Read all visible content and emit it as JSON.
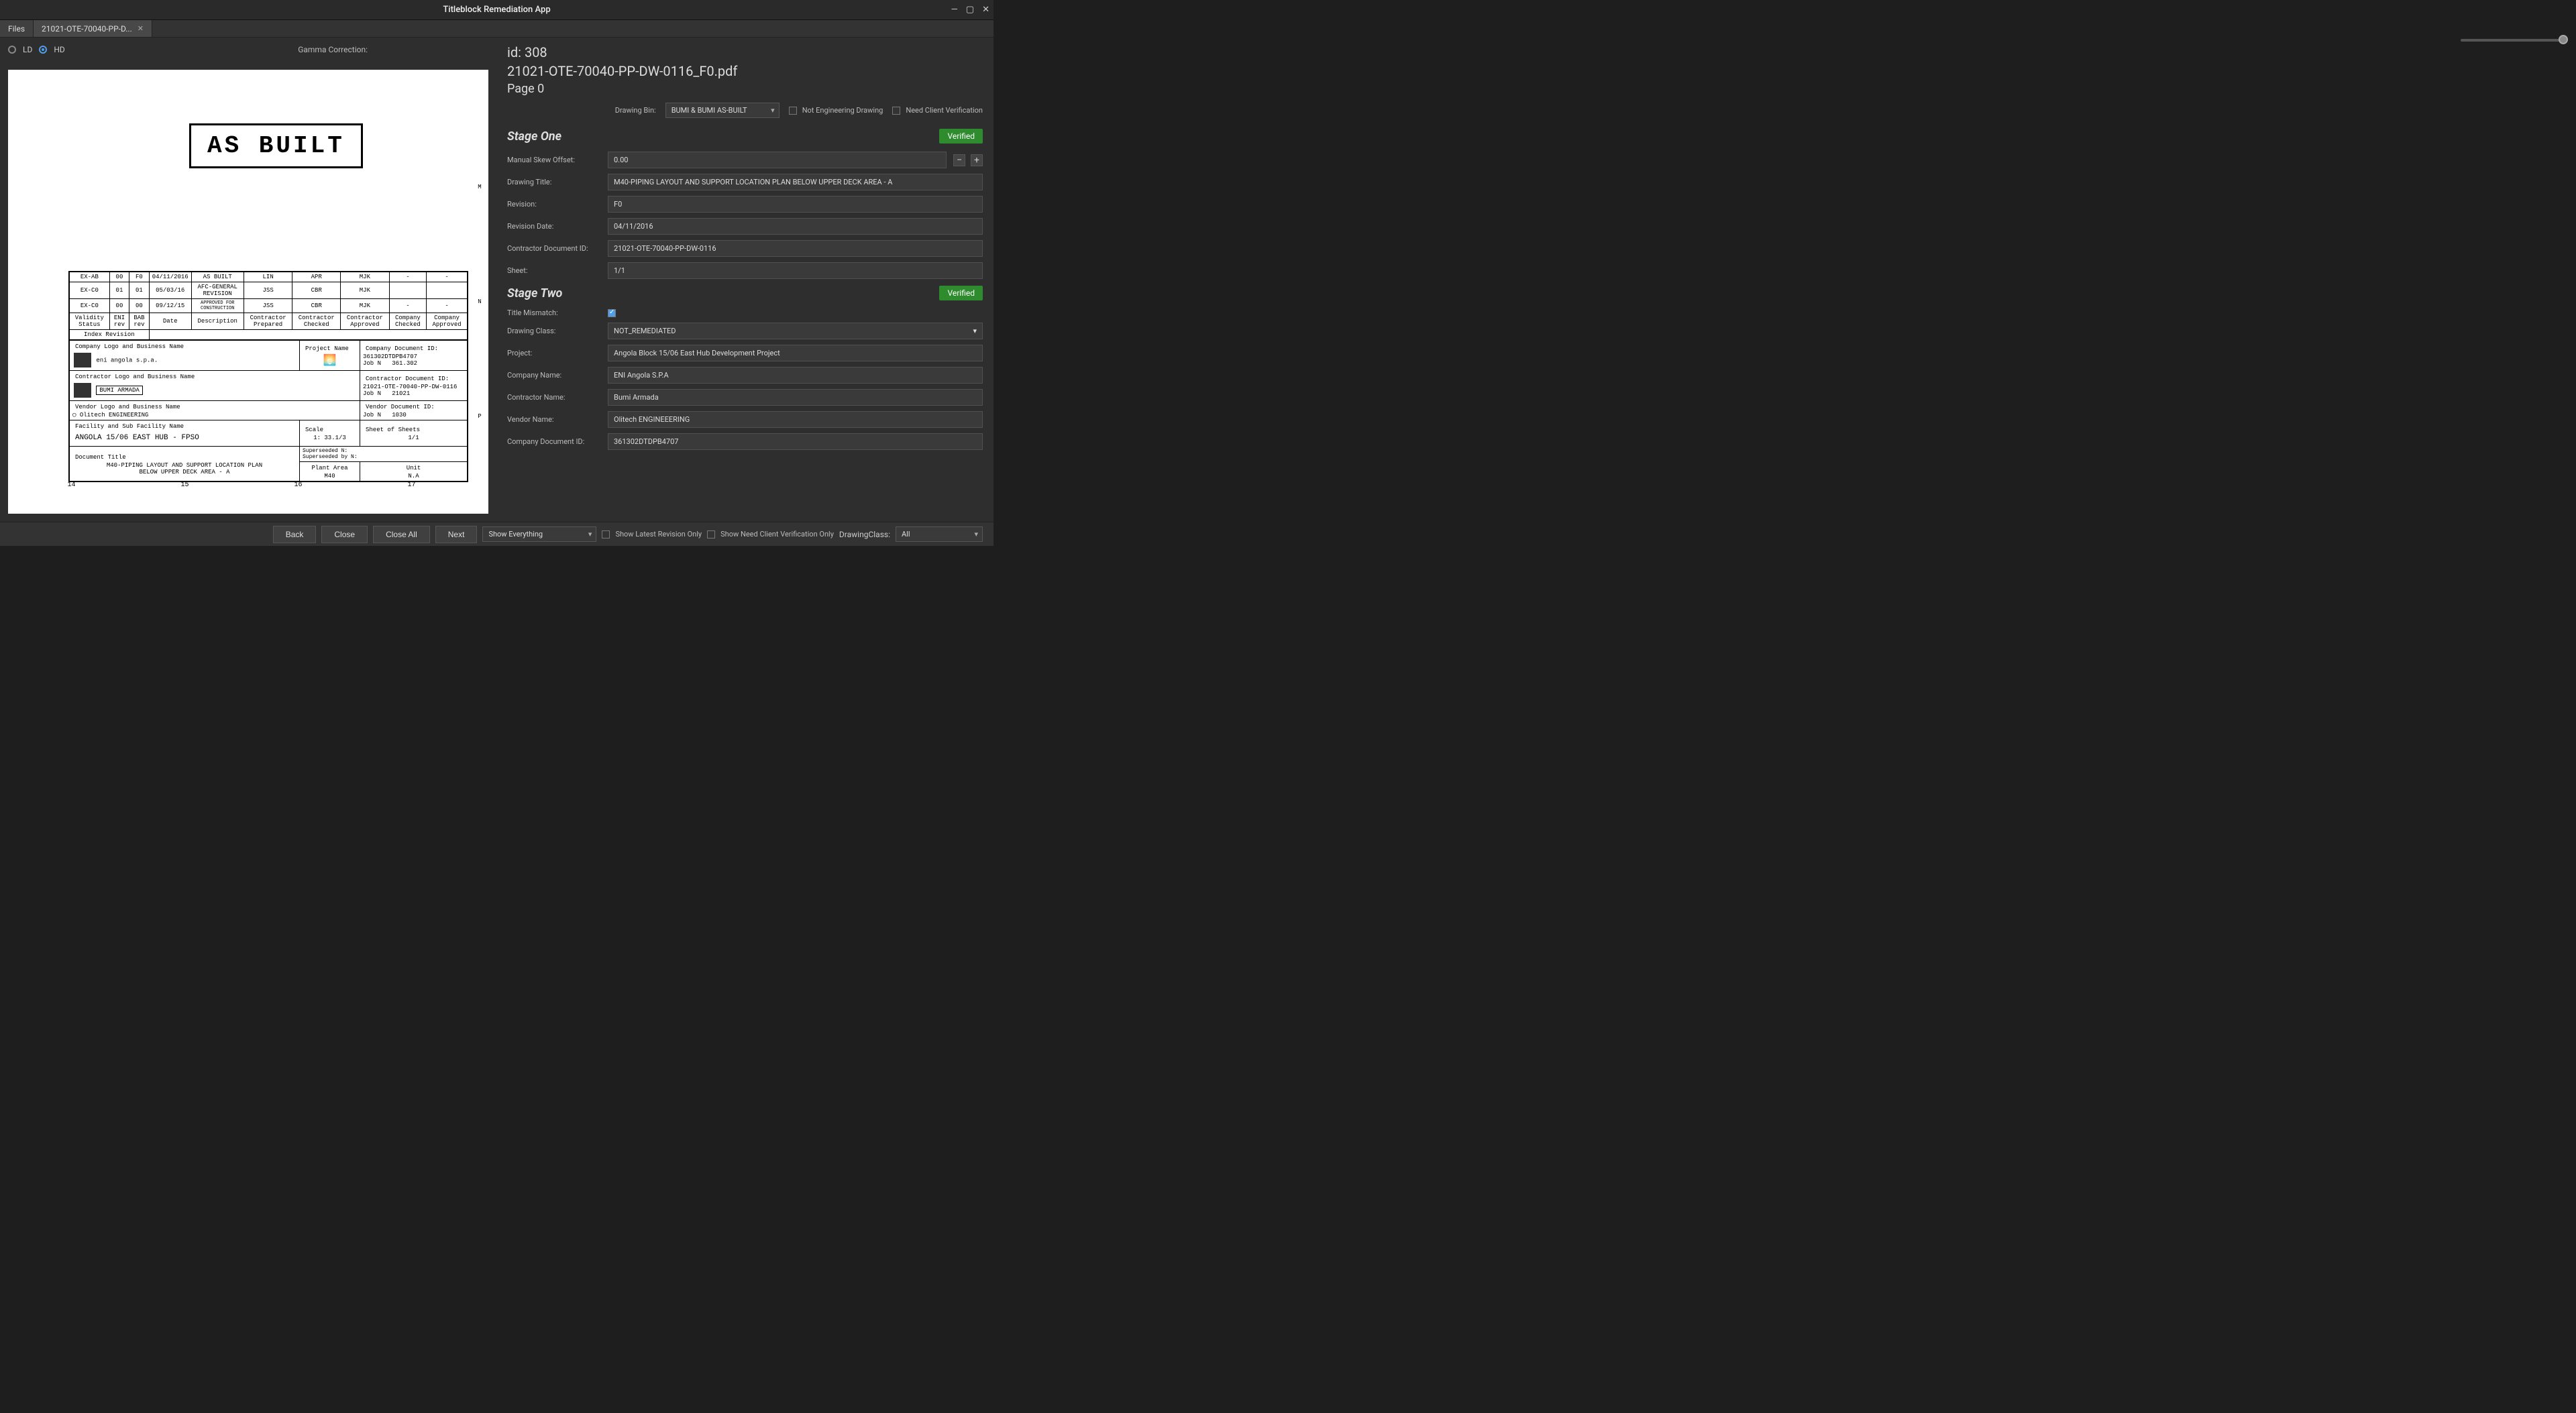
{
  "window": {
    "title": "Titleblock Remediation App"
  },
  "tabs": {
    "files": "Files",
    "docTab": "21021-OTE-70040-PP-D..."
  },
  "viewer": {
    "ldLabel": "LD",
    "hdLabel": "HD",
    "gammaLabel": "Gamma Correction:",
    "asbuilt": "AS BUILT",
    "rulerRight": {
      "m": "M",
      "n": "N",
      "p": "P"
    },
    "rulerBot": {
      "r14": "14",
      "r15": "15",
      "r16": "16",
      "r17": "17"
    },
    "revRows": [
      {
        "status": "EX-AB",
        "eni": "00",
        "bab": "F0",
        "date": "04/11/2016",
        "desc": "AS BUILT",
        "prep": "LIN",
        "chk": "APR",
        "appr": "MJK",
        "cchk": "-",
        "capp": "-"
      },
      {
        "status": "EX-C0",
        "eni": "01",
        "bab": "01",
        "date": "05/03/16",
        "desc": "AFC-GENERAL REVISION",
        "prep": "JSS",
        "chk": "CBR",
        "appr": "MJK",
        "cchk": "",
        "capp": ""
      },
      {
        "status": "EX-C0",
        "eni": "00",
        "bab": "00",
        "date": "09/12/15",
        "desc": "APPROVED FOR CONSTRUCTION",
        "prep": "JSS",
        "chk": "CBR",
        "appr": "MJK",
        "cchk": "-",
        "capp": "-"
      }
    ],
    "revHdr": {
      "status": "Validity Status",
      "eni": "ENI rev",
      "bab": "BAB rev",
      "date": "Date",
      "desc": "Description",
      "prep": "Contractor Prepared",
      "chk": "Contractor Checked",
      "appr": "Contractor Approved",
      "cchk": "Company Checked",
      "capp": "Company Approved"
    },
    "indexRev": "Index Revision",
    "companyLogoLbl": "Company Logo and Business Name",
    "companyName": "eni angola s.p.a.",
    "projectNameLbl": "Project Name",
    "compDocIdLbl": "Company Document ID:",
    "compDocId": "361302DTDPB4707",
    "jobNLbl": "Job N",
    "jobN1": "361.302",
    "contractorLogoLbl": "Contractor Logo and Business Name",
    "contractorName": "BUMI ARMADA",
    "contrDocIdLbl": "Contractor Document ID:",
    "contrDocId": "21021-OTE-70040-PP-DW-0116",
    "jobN2": "21021",
    "vendorLogoLbl": "Vendor Logo and Business Name",
    "vendorName": "Olitech ENGINEERING",
    "vendorDocIdLbl": "Vendor Document ID:",
    "jobN3": "1030",
    "facilityLbl": "Facility and Sub Facility Name",
    "facility": "ANGOLA 15/06 EAST HUB - FPSO",
    "scaleLbl": "Scale",
    "scale": "1: 33.1/3",
    "sheetOfLbl": "Sheet of Sheets",
    "sheetOf": "1/1",
    "docTitleLbl": "Document Title",
    "docTitle1": "M40-PIPING LAYOUT AND SUPPORT LOCATION PLAN",
    "docTitle2": "BELOW UPPER DECK AREA - A",
    "supersededNLbl": "Superseeded N:",
    "supersededByLbl": "Superseeded by N:",
    "plantAreaLbl": "Plant Area",
    "plantArea": "M40",
    "unitLbl": "Unit",
    "unit": "N.A"
  },
  "form": {
    "id": "id: 308",
    "file": "21021-OTE-70040-PP-DW-0116_F0.pdf",
    "page": "Page 0",
    "drawingBinLbl": "Drawing Bin:",
    "drawingBin": "BUMI & BUMI AS-BUILT",
    "notEngLbl": "Not Engineering Drawing",
    "needClientLbl": "Need Client Verification",
    "stage1": "Stage One",
    "stage2": "Stage Two",
    "verified": "Verified",
    "fields1": {
      "skewLbl": "Manual Skew Offset:",
      "skew": "0.00",
      "titleLbl": "Drawing Title:",
      "title": "M40-PIPING LAYOUT AND SUPPORT LOCATION PLAN BELOW UPPER DECK AREA - A",
      "revLbl": "Revision:",
      "rev": "F0",
      "revDateLbl": "Revision Date:",
      "revDate": "04/11/2016",
      "cdocLbl": "Contractor Document ID:",
      "cdoc": "21021-OTE-70040-PP-DW-0116",
      "sheetLbl": "Sheet:",
      "sheet": "1/1"
    },
    "fields2": {
      "mismatchLbl": "Title Mismatch:",
      "classLbl": "Drawing Class:",
      "class": "NOT_REMEDIATED",
      "projLbl": "Project:",
      "proj": "Angola Block 15/06 East Hub Development Project",
      "compLbl": "Company Name:",
      "comp": "ENI Angola S.P.A",
      "contrLbl": "Contractor Name:",
      "contr": "Bumi Armada",
      "vendLbl": "Vendor Name:",
      "vend": "Olitech ENGINEEERING",
      "compDocLbl": "Company Document ID:",
      "compDoc": "361302DTDPB4707"
    }
  },
  "bottom": {
    "back": "Back",
    "close": "Close",
    "closeAll": "Close All",
    "next": "Next",
    "showEverything": "Show Everything",
    "showLatest": "Show Latest Revision Only",
    "showNeedClient": "Show Need Client Verification Only",
    "drawingClassLbl": "DrawingClass:",
    "drawingClass": "All"
  }
}
